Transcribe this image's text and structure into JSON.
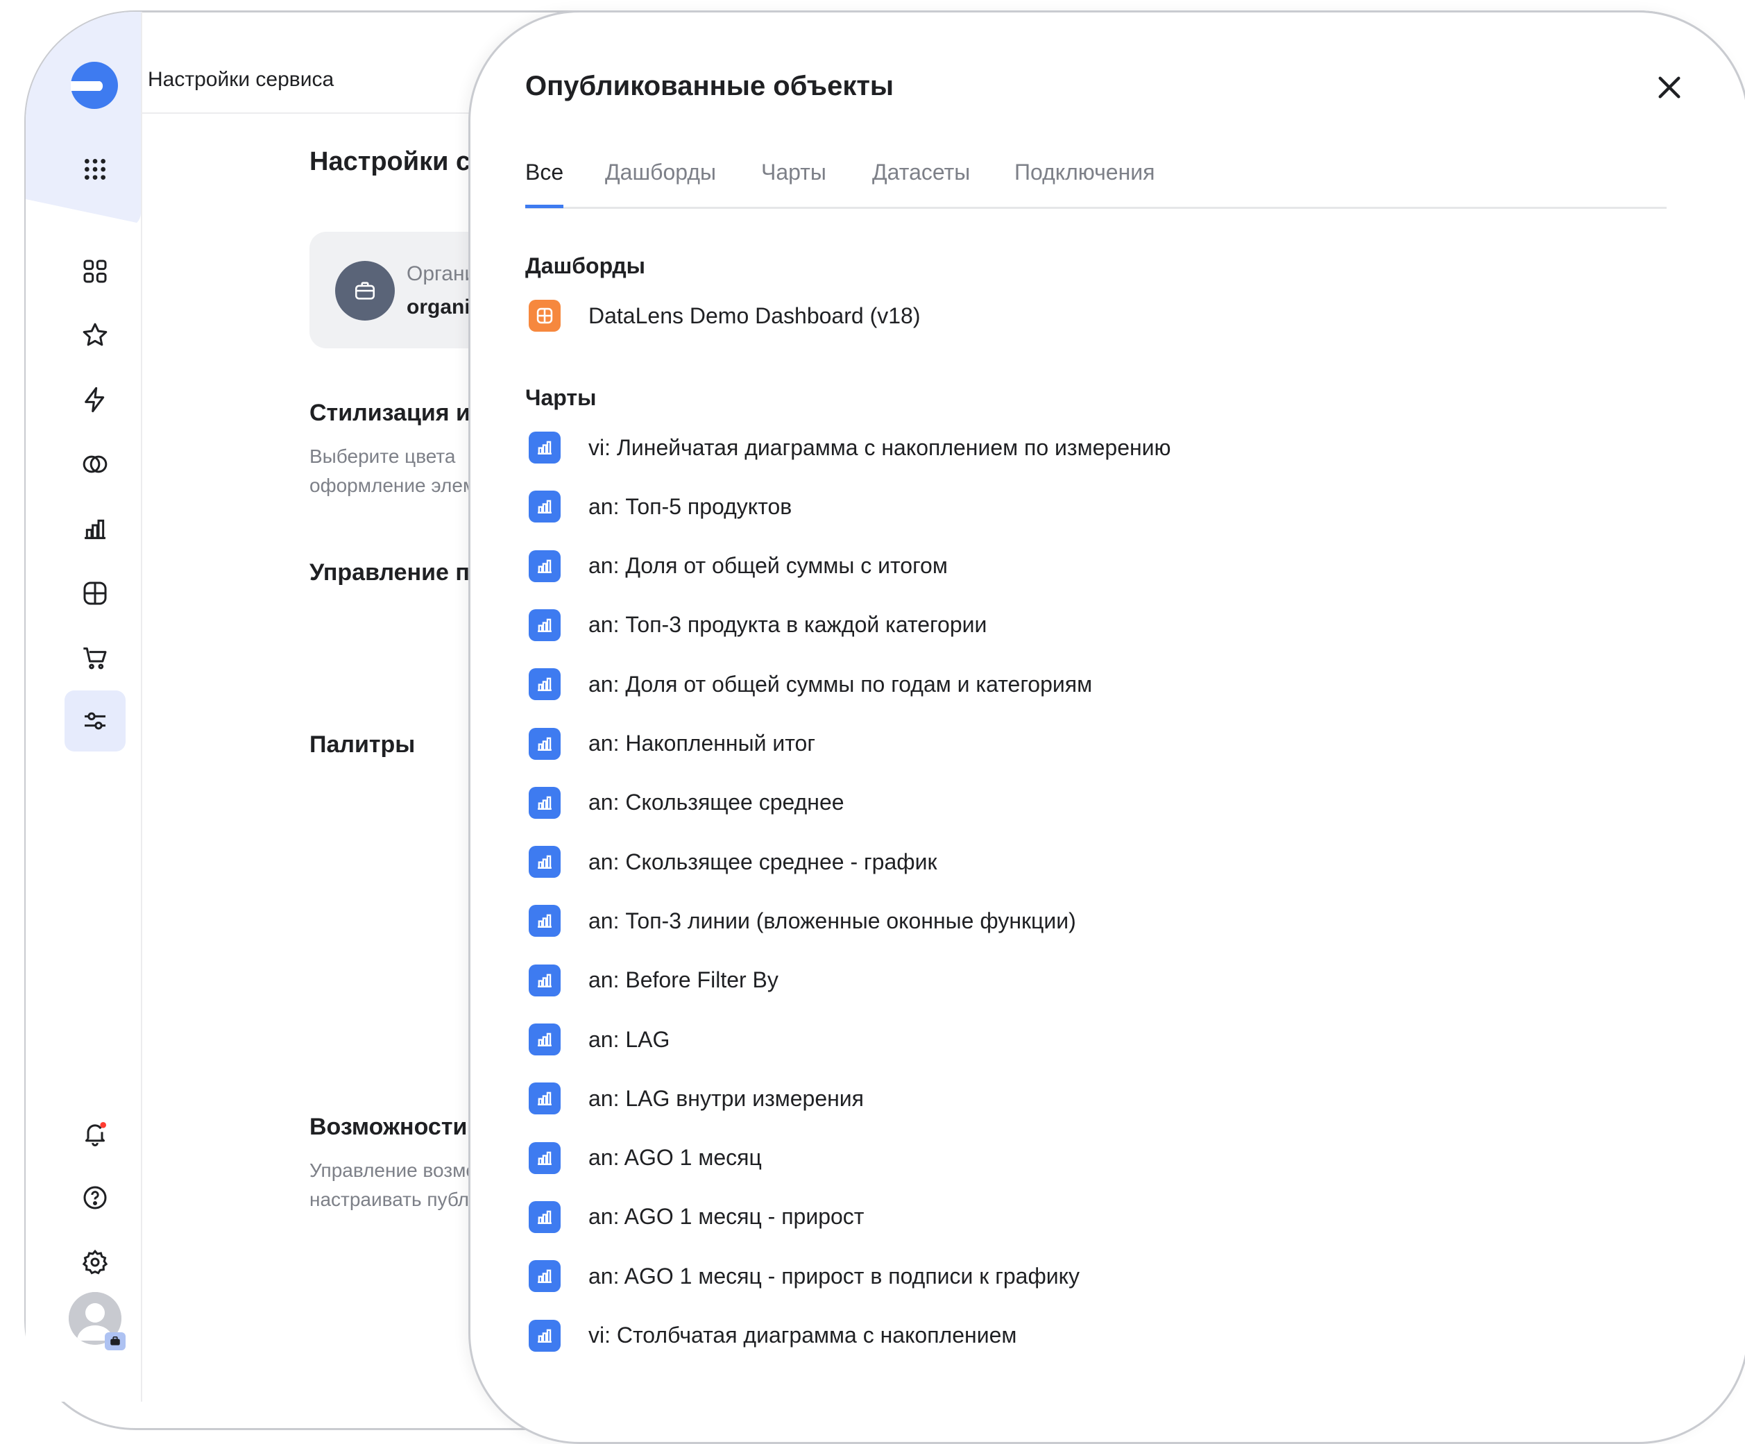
{
  "app": {
    "header_title": "Настройки сервиса",
    "page_title": "Настройки сервиса",
    "organization": {
      "label": "Организация",
      "name": "organization"
    },
    "sections": [
      {
        "title": "Стилизация интерфейса",
        "desc_line1": "Выберите цвета",
        "desc_line2": "оформление элементов"
      },
      {
        "title": "Управление пользователями"
      },
      {
        "title": "Палитры"
      },
      {
        "title": "Возможности",
        "desc_line1": "Управление возможностями",
        "desc_line2": "настраивать публикацию"
      }
    ]
  },
  "nav": {
    "icons": [
      "logo-icon",
      "apps-grid-icon",
      "collections-icon",
      "favorites-star-icon",
      "connections-lightning-icon",
      "datasets-rings-icon",
      "charts-icon",
      "dashboards-icon",
      "marketplace-cart-icon",
      "settings-sliders-icon",
      "notifications-bell-icon",
      "help-icon",
      "gear-icon",
      "avatar"
    ]
  },
  "drawer": {
    "title": "Опубликованные объекты",
    "tabs": [
      "Все",
      "Дашборды",
      "Чарты",
      "Датасеты",
      "Подключения"
    ],
    "active_tab": "Все",
    "dashboards_label": "Дашборды",
    "dashboards": [
      "DataLens Demo Dashboard (v18)"
    ],
    "charts_label": "Чарты",
    "charts": [
      "vi: Линейчатая диаграмма с накоплением по измерению",
      "an: Топ-5 продуктов",
      "an: Доля от общей суммы с итогом",
      "an: Топ-3 продукта в каждой категории",
      "an: Доля от общей суммы по годам и категориям",
      "an: Накопленный итог",
      "an: Скользящее среднее",
      "an: Скользящее среднее - график",
      "an: Топ-3 линии (вложенные оконные функции)",
      "an: Before Filter By",
      "an: LAG",
      "an: LAG внутри измерения",
      "an: AGO 1 месяц",
      "an: AGO 1 месяц - прирост",
      "an: AGO 1 месяц - прирост в подписи к графику",
      "vi: Столбчатая диаграмма с накоплением"
    ]
  },
  "colors": {
    "accent": "#3e7bf0",
    "dashboard_icon": "#f6883e",
    "nav_highlight": "#eaeefc",
    "notification_dot": "#ff3b30"
  }
}
